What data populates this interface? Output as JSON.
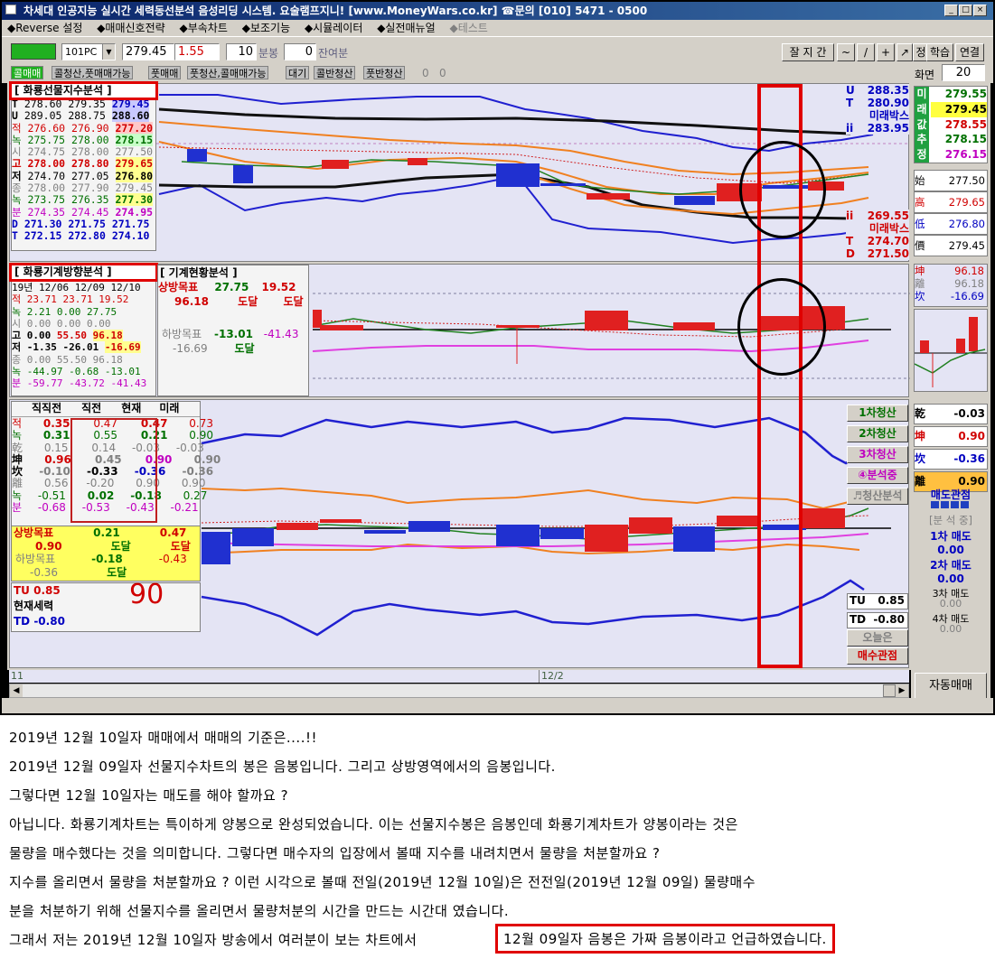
{
  "window": {
    "title": "차세대 인공지능 실시간 세력동선분석 음성리딩 시스템. 요술램프지니! [www.MoneyWars.co.kr] ☎문의 [010] 5471 - 0500"
  },
  "menu": [
    "◆Reverse 설정",
    "◆매매신호전략",
    "◆부속차트",
    "◆보조기능",
    "◆시뮬레이터",
    "◆실전매뉴얼",
    "◆테스트"
  ],
  "toolbar": {
    "code": "101PC",
    "price": "279.45",
    "change": "1.55",
    "period": "10",
    "period_unit": "분봉",
    "remain": "0",
    "remain_label": "잔여분",
    "buttons": [
      "잘 지 간",
      "~",
      "/",
      "+",
      "↗",
      "정",
      "학습",
      "연결"
    ]
  },
  "tabs": [
    "콜매매",
    "콜청산,풋매매가능",
    "풋매매",
    "풋청산,콜매매가능",
    "대기",
    "콜반청산",
    "풋반청산"
  ],
  "tab_counts": [
    "0",
    "0"
  ],
  "screen": {
    "label": "화면",
    "value": "20"
  },
  "panel1": {
    "title": "[ 화룡선물지수분석 ]",
    "rows": [
      [
        "T",
        "278.60",
        "279.35",
        "279.45"
      ],
      [
        "U",
        "289.05",
        "288.75",
        "288.60"
      ],
      [
        "적",
        "276.60",
        "276.90",
        "277.20"
      ],
      [
        "녹",
        "275.75",
        "278.00",
        "278.15"
      ],
      [
        "시",
        "274.75",
        "278.00",
        "277.50"
      ],
      [
        "고",
        "278.00",
        "278.80",
        "279.65"
      ],
      [
        "저",
        "274.70",
        "277.05",
        "276.80"
      ],
      [
        "종",
        "278.00",
        "277.90",
        "279.45"
      ],
      [
        "녹",
        "273.75",
        "276.35",
        "277.30"
      ],
      [
        "분",
        "274.35",
        "274.45",
        "274.95"
      ],
      [
        "D",
        "271.30",
        "271.75",
        "271.75"
      ],
      [
        "T",
        "272.15",
        "272.80",
        "274.10"
      ]
    ],
    "right_top": [
      {
        "k": "U",
        "v": "288.35"
      },
      {
        "k": "T",
        "v": "280.90"
      },
      {
        "k": "",
        "v": "미래박스"
      },
      {
        "k": "ii",
        "v": "283.95"
      }
    ],
    "right_bot": [
      {
        "k": "ii",
        "v": "269.55"
      },
      {
        "k": "",
        "v": "미래박스"
      },
      {
        "k": "T",
        "v": "274.70"
      },
      {
        "k": "D",
        "v": "271.50"
      }
    ]
  },
  "panel2": {
    "title": "[ 화룡기계방향분석 ]",
    "title2": "[ 기계현황분석 ]",
    "dates": [
      "19년 12/06",
      "12/09",
      "12/10"
    ],
    "rows": [
      [
        "적",
        "23.71",
        "23.71",
        "19.52"
      ],
      [
        "녹",
        "2.21",
        "0.00",
        "27.75"
      ],
      [
        "시",
        "0.00",
        "0.00",
        "0.00"
      ],
      [
        "고",
        "0.00",
        "55.50",
        "96.18"
      ],
      [
        "저",
        "-1.35",
        "-26.01",
        "-16.69"
      ],
      [
        "종",
        "0.00",
        "55.50",
        "96.18"
      ],
      [
        "녹",
        "-44.97",
        "-0.68",
        "-13.01"
      ],
      [
        "분",
        "-59.77",
        "-43.72",
        "-41.43"
      ]
    ],
    "status": {
      "up_label": "상방목표",
      "up1": "27.75",
      "up2": "19.52",
      "up_v": "96.18",
      "reach": "도달",
      "down_label": "하방목표",
      "d1": "-13.01",
      "d2": "-41.43",
      "d_v": "-16.69"
    }
  },
  "panel3": {
    "headers": [
      "직직전",
      "직전",
      "현재",
      "미래"
    ],
    "rows": [
      [
        "적",
        "0.35",
        "0.47",
        "0.47",
        "0.73"
      ],
      [
        "녹",
        "0.31",
        "0.55",
        "0.21",
        "0.90"
      ],
      [
        "乾",
        "0.15",
        "0.14",
        "-0.03",
        "-0.03"
      ],
      [
        "坤",
        "0.96",
        "0.45",
        "0.90",
        "0.90"
      ],
      [
        "坎",
        "-0.10",
        "-0.33",
        "-0.36",
        "-0.36"
      ],
      [
        "離",
        "0.56",
        "-0.20",
        "0.90",
        "0.90"
      ],
      [
        "녹",
        "-0.51",
        "0.02",
        "-0.18",
        "0.27"
      ],
      [
        "분",
        "-0.68",
        "-0.53",
        "-0.43",
        "-0.21"
      ]
    ],
    "up_label": "상방목표",
    "up_a": "0.21",
    "up_b": "0.47",
    "up_c": "0.90",
    "reach": "도달",
    "down_label": "하방목표",
    "down_a": "-0.18",
    "down_b": "-0.43",
    "down_c": "-0.36",
    "tu": "TU  0.85",
    "force": "현재세력",
    "td": "TD -0.80",
    "big": "90",
    "right_buttons": [
      "1차청산",
      "2차청산",
      "3차청산",
      "④분석중",
      "♬청산분석"
    ],
    "tu_r": "0.85",
    "td_r": "-0.80",
    "today": "오늘은",
    "buy_watch": "매수관점"
  },
  "right": {
    "vals": [
      {
        "k": "미",
        "v": "279.55"
      },
      {
        "k": "래",
        "v": "279.45"
      },
      {
        "k": "값",
        "v": "278.55"
      },
      {
        "k": "추",
        "v": "278.15"
      },
      {
        "k": "정",
        "v": "276.15"
      }
    ],
    "ohlc": [
      {
        "k": "始",
        "v": "277.50"
      },
      {
        "k": "高",
        "v": "279.65"
      },
      {
        "k": "低",
        "v": "276.80"
      },
      {
        "k": "價",
        "v": "279.45"
      }
    ],
    "p2": [
      {
        "k": "坤",
        "v": "96.18"
      },
      {
        "k": "離",
        "v": "96.18"
      },
      {
        "k": "坎",
        "v": "-16.69"
      }
    ],
    "p3": [
      {
        "k": "乾",
        "v": "-0.03"
      },
      {
        "k": "坤",
        "v": "0.90"
      },
      {
        "k": "坎",
        "v": "-0.36"
      },
      {
        "k": "離",
        "v": "0.90"
      }
    ],
    "sell_watch": "매도관점",
    "analyzing": "[분 석 중]",
    "sell": [
      {
        "k": "1차 매도",
        "v": "0.00"
      },
      {
        "k": "2차 매도",
        "v": "0.00"
      },
      {
        "k": "3차 매도",
        "v": "0.00"
      },
      {
        "k": "4차 매도",
        "v": "0.00"
      }
    ],
    "auto": "자동매매"
  },
  "axis": {
    "left": "11",
    "mid": "12/2"
  },
  "text": [
    "2019년 12월 10일자 매매에서 매매의 기준은....!!",
    "2019년 12월 09일자 선물지수차트의 봉은 음봉입니다. 그리고 상방영역에서의 음봉입니다.",
    "그렇다면 12월 10일자는 매도를 해야 할까요 ?",
    "아닙니다. 화룡기계차트는 특이하게 양봉으로 완성되었습니다. 이는 선물지수봉은 음봉인데 화룡기계차트가 양봉이라는 것은",
    "물량을 매수했다는 것을 의미합니다. 그렇다면 매수자의 입장에서 볼때 지수를 내려치면서 물량을 처분할까요 ?",
    "지수를 올리면서 물량을 처분할까요 ?   이런 시각으로 볼때 전일(2019년 12월 10일)은 전전일(2019년 12월 09일) 물량매수",
    "분을 처분하기 위해 선물지수를 올리면서 물량처분의 시간을 만드는 시간대 였습니다.",
    "그래서 저는 2019년 12월 10일자 방송에서 여러분이 보는 차트에서"
  ],
  "highlight": "12월 09일자 음봉은 가짜 음봉이라고 언급하였습니다."
}
